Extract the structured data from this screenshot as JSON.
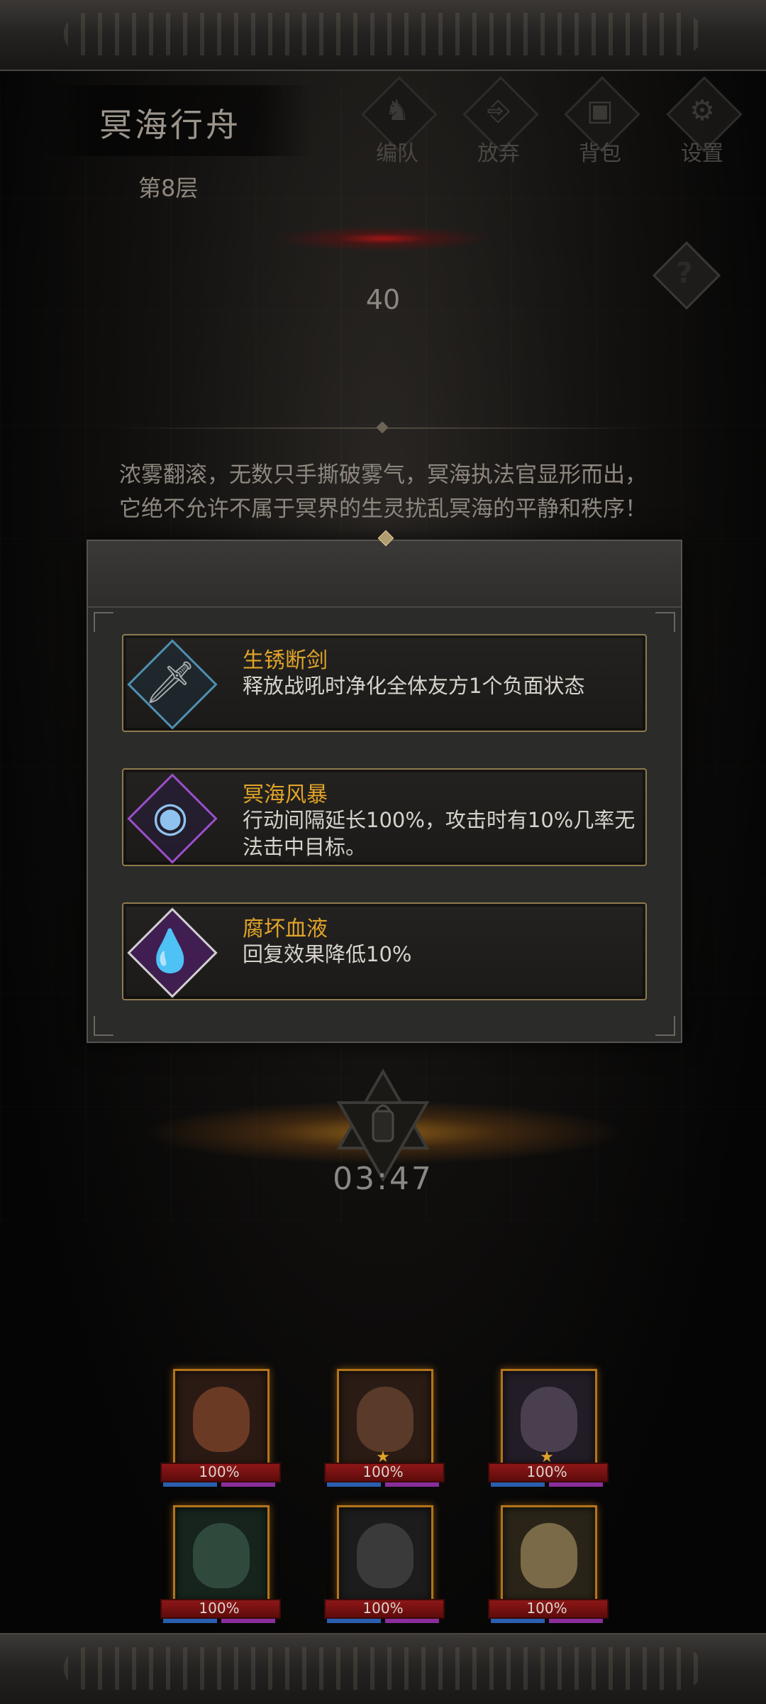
{
  "header": {
    "stage_title": "冥海行舟",
    "floor": "第8层",
    "menu": [
      {
        "label": "编队",
        "icon": "horned-helmet-icon",
        "glyph": "♞"
      },
      {
        "label": "放弃",
        "icon": "exit-door-icon",
        "glyph": "⎆"
      },
      {
        "label": "背包",
        "icon": "backpack-icon",
        "glyph": "▣"
      },
      {
        "label": "设置",
        "icon": "gear-icon",
        "glyph": "⚙"
      }
    ],
    "help_glyph": "?",
    "counter": "40"
  },
  "story": "浓雾翻滚，无数只手撕破雾气，冥海执法官显形而出，它绝不允许不属于冥界的生灵扰乱冥海的平静和秩序！",
  "effects": [
    {
      "title": "生锈断剑",
      "desc": "释放战吼时净化全体友方1个负面状态",
      "icon": "broken-sword-icon",
      "glyph": "🗡",
      "frame_color": "#4f8fb0"
    },
    {
      "title": "冥海风暴",
      "desc": "行动间隔延长100%，攻击时有10%几率无法击中目标。",
      "icon": "storm-orb-icon",
      "glyph": "◉",
      "frame_color": "#9b4fc9"
    },
    {
      "title": "腐坏血液",
      "desc": "回复效果降低10%",
      "icon": "blood-drops-icon",
      "glyph": "💧",
      "frame_color": "#cfcfcf"
    }
  ],
  "timer": "03:47",
  "heroes": [
    {
      "hp": "100%",
      "tone": "#6b3a25"
    },
    {
      "hp": "100%",
      "tone": "#5a3a28"
    },
    {
      "hp": "100%",
      "tone": "#4a3f4e"
    },
    {
      "hp": "100%",
      "tone": "#2f4a3c"
    },
    {
      "hp": "100%",
      "tone": "#3b3a3a"
    },
    {
      "hp": "100%",
      "tone": "#7a6a48"
    }
  ],
  "colors": {
    "accent_gold": "#e1a429",
    "card_border": "#8e7a4f",
    "hp_red": "#8e1717"
  }
}
